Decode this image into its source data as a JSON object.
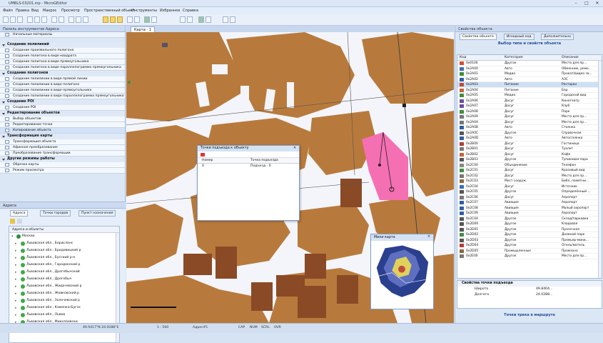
{
  "window": {
    "title": "UMBLS-03201.mp - MicroGEditor",
    "controls": [
      "–",
      "□",
      "✕"
    ]
  },
  "menu": [
    "Файл",
    "Правка",
    "Вид",
    "Макрос",
    "Просмотр",
    "Пространственный объект",
    "Инструменты",
    "Избранное",
    "Справка"
  ],
  "left_panel": {
    "title": "Панель инструментов Адреса",
    "subtitle": "Начальные материалы",
    "sections": [
      {
        "label": "Создание полилиний",
        "items": [
          "Создание произвольного полигона",
          "Создание полигона в виде квадрата",
          "Создание полигона в виде прямоугольника",
          "Создание полигона в виде параллелограмма прямоугольника"
        ]
      },
      {
        "label": "Создание полигонов",
        "items": [
          "Создание полилинии в виде прямой линии",
          "Создание полилинии в виде полигона",
          "Создание полилинии в виде прямоугольника",
          "Создание полилинии в виде параллелограмма прямоугольника"
        ]
      },
      {
        "label": "Создание POI",
        "items": [
          "Создание POI"
        ]
      },
      {
        "label": "Редактирование объектов",
        "items": [
          "Выбор объектов",
          "Редактирование точки",
          "Копирование объекта"
        ]
      },
      {
        "label": "Трансформация карты",
        "items": [
          "Трансформация объекта",
          "Афинное преобразование",
          "Преобразование трансформации"
        ]
      },
      {
        "label": "Другие режимы работы",
        "items": [
          "Обрезка карты",
          "Режим просмотра"
        ]
      }
    ]
  },
  "address_panel": {
    "title": "Адреса",
    "tabs": [
      "Адреса",
      "Точки городов",
      "Пункт назначения"
    ],
    "tree_header": "Адреса и объекты",
    "root": "Москва",
    "items": [
      "Львовская обл., Борисланс",
      "Львовская обл., Бродовицкий р",
      "Львовская обл., Бусский р-н",
      "Львовская обл., Городокский р",
      "Львовская обл., Дрогобычский",
      "Львовская обл., Дрогобыч",
      "Львовская обл., Жидачевский р",
      "Львовская обл., Жовковский р",
      "Львовская обл., Золочевский р",
      "Львовская обл., Каменка-Бугск",
      "Львовская обл., Львов",
      "Львовская обл., Миколаевски"
    ]
  },
  "map": {
    "tab_label": "Карта - 1",
    "colors": {
      "building": "#b87a3c",
      "building_dark": "#8a4a26",
      "highlight": "#f56fb3",
      "road": "#f7f7fb",
      "line": "#4a4a4a"
    }
  },
  "dialog": {
    "title": "Точки подъезда к объекту",
    "col_number": "Номер",
    "col_point": "Точка подъезда",
    "row_number": "0",
    "row_point": "Подъезд - 0"
  },
  "minimap": {
    "title": "Мини карта"
  },
  "status": {
    "coords": "49.9417°N 24.0288°E",
    "scale": "1 : 500",
    "mode": "Адрес#1",
    "flags": [
      "CAP",
      "NUM",
      "SCRL",
      "OVR"
    ]
  },
  "right_panel": {
    "title": "Свойства объекта",
    "tabs": [
      "Свойства объекта",
      "Исходный код",
      "Дополнительно"
    ],
    "subtitle": "Выбор типа и свойств объекта",
    "columns": [
      "Код",
      "Категория",
      "Описание"
    ],
    "rows": [
      {
        "code": "0x0100",
        "cat": "Другое",
        "desc": "Место для пр...",
        "color": "#d94d2a"
      },
      {
        "code": "0x2A00",
        "cat": "Авто",
        "desc": "Обменник, ремо...",
        "color": "#3b6fb6"
      },
      {
        "code": "0x2A01",
        "cat": "Медиа",
        "desc": "Прокат/видео за...",
        "color": "#3f8f3f"
      },
      {
        "code": "0x2A02",
        "cat": "Авто",
        "desc": "АЗС",
        "color": "#2e5fa8"
      },
      {
        "code": "0x2A03",
        "cat": "Питание",
        "desc": "Ресторан",
        "color": "#c04a3c"
      },
      {
        "code": "0x2A04",
        "cat": "Питание",
        "desc": "Бар",
        "color": "#c4633a"
      },
      {
        "code": "0x2A05",
        "cat": "Медиа",
        "desc": "Городской вид",
        "color": "#3f8f3f"
      },
      {
        "code": "0x2A06",
        "cat": "Досуг",
        "desc": "Кинотеатр",
        "color": "#6a4ea3"
      },
      {
        "code": "0x2A07",
        "cat": "Досуг",
        "desc": "Клуб",
        "color": "#6a4ea3"
      },
      {
        "code": "0x2A08",
        "cat": "Досуг",
        "desc": "Парк",
        "color": "#3f8f3f"
      },
      {
        "code": "0x2A09",
        "cat": "Досуг",
        "desc": "Место для пр...",
        "color": "#777"
      },
      {
        "code": "0x2A0A",
        "cat": "Досуг",
        "desc": "Место для пр...",
        "color": "#777"
      },
      {
        "code": "0x2A0B",
        "cat": "Авто",
        "desc": "Стоянка",
        "color": "#2e5fa8"
      },
      {
        "code": "0x2A0C",
        "cat": "Другое",
        "desc": "Справочная",
        "color": "#555"
      },
      {
        "code": "0x2A0D",
        "cat": "Авто",
        "desc": "Автостоянка",
        "color": "#2e5fa8"
      },
      {
        "code": "0x2B00",
        "cat": "Досуг",
        "desc": "Гостиница",
        "color": "#b53a3a"
      },
      {
        "code": "0x2B01",
        "cat": "Досуг",
        "desc": "Туалет",
        "color": "#777"
      },
      {
        "code": "0x2B02",
        "cat": "Досуг",
        "desc": "Кафе",
        "color": "#c4633a"
      },
      {
        "code": "0x2B03",
        "cat": "Другое",
        "desc": "Тупиковая пара",
        "color": "#555"
      },
      {
        "code": "0x2C00",
        "cat": "Объединение",
        "desc": "Телефон",
        "color": "#888"
      },
      {
        "code": "0x2C01",
        "cat": "Досуг",
        "desc": "Красивый вид",
        "color": "#3f8f3f"
      },
      {
        "code": "0x2C02",
        "cat": "Досуг",
        "desc": "Место для пр...",
        "color": "#777"
      },
      {
        "code": "0x2C03",
        "cat": "Мост сооруж.",
        "desc": "Библ, памятни...",
        "color": "#8a6a3a"
      },
      {
        "code": "0x2C04",
        "cat": "Досуг",
        "desc": "Источник",
        "color": "#3b6fb6"
      },
      {
        "code": "0x2C05",
        "cat": "Другое",
        "desc": "Определённый ...",
        "color": "#555"
      },
      {
        "code": "0x2C06",
        "cat": "Досуг",
        "desc": "Аэропорт",
        "color": "#777"
      },
      {
        "code": "0x2C07",
        "cat": "Авиация",
        "desc": "Аэропорт",
        "color": "#2e5fa8"
      },
      {
        "code": "0x2C08",
        "cat": "Авиация",
        "desc": "Малый аэропорт",
        "color": "#2e5fa8"
      },
      {
        "code": "0x2C09",
        "cat": "Авиация",
        "desc": "Аэропорт",
        "color": "#2e5fa8"
      },
      {
        "code": "0x2C0A",
        "cat": "Другое",
        "desc": "Склад/парковка",
        "color": "#555"
      },
      {
        "code": "0x2D00",
        "cat": "Другое",
        "desc": "Кладовая",
        "color": "#555"
      },
      {
        "code": "0x2D01",
        "cat": "Другое",
        "desc": "Прачечная",
        "color": "#555"
      },
      {
        "code": "0x2D02",
        "cat": "Другое",
        "desc": "Дневной парк",
        "color": "#3f8f3f"
      },
      {
        "code": "0x2D03",
        "cat": "Другое",
        "desc": "Премьер-мини...",
        "color": "#555"
      },
      {
        "code": "0x2D04",
        "cat": "Другое",
        "desc": "Отель/мотель",
        "color": "#b53a3a"
      },
      {
        "code": "0x2D05",
        "cat": "Промышленные",
        "desc": "Промзона",
        "color": "#8a6a3a"
      },
      {
        "code": "0x2E00",
        "cat": "Другое",
        "desc": "Место для пр...",
        "color": "#777"
      }
    ],
    "props_title": "Свойства точки подъезда",
    "props": [
      {
        "k": "Широта",
        "v": "49.8404..."
      },
      {
        "k": "Долгота",
        "v": "24.0288..."
      }
    ],
    "bottom_link": "Точки трека в маршруте"
  }
}
